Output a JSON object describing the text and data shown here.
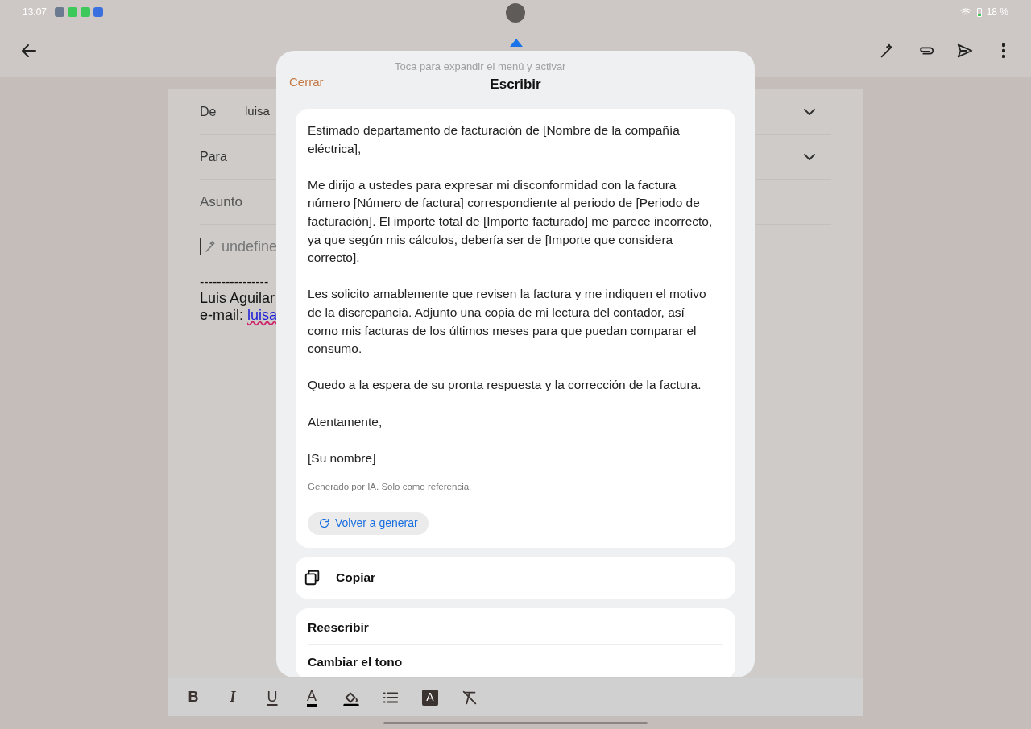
{
  "status_bar": {
    "time": "13:07",
    "battery": "18 %"
  },
  "compose": {
    "fields": [
      {
        "label": "De",
        "value": "luisa",
        "dropdown": true
      },
      {
        "label": "Para",
        "dropdown": true
      },
      {
        "label": "Asunto",
        "dropdown": false
      }
    ],
    "body_placeholder": "undefine",
    "signature": {
      "divider": "----------------",
      "name": "Luis Aguilar",
      "email_label": "e-mail:",
      "email_link": "luisa"
    }
  },
  "format_toolbar": [
    {
      "kind": "bold",
      "glyph": "B"
    },
    {
      "kind": "italic",
      "glyph": "I"
    },
    {
      "kind": "underline",
      "glyph": "U"
    },
    {
      "kind": "text-color",
      "glyph": "A"
    },
    {
      "kind": "fill"
    },
    {
      "kind": "list"
    },
    {
      "kind": "highlight",
      "glyph": "A"
    },
    {
      "kind": "clear"
    }
  ],
  "tooltip": "Toca para expandir el menú y activar",
  "sheet": {
    "close": "Cerrar",
    "title": "Escribir",
    "paragraphs": [
      "Estimado departamento de facturación de [Nombre de la compañía eléctrica],",
      "Me dirijo a ustedes para expresar mi disconformidad con la factura número [Número de factura] correspondiente al periodo de [Periodo de facturación]. El importe total de [Importe facturado] me parece incorrecto, ya que según mis cálculos, debería ser de [Importe que considera correcto].",
      "Les solicito amablemente que revisen la factura y me indiquen el motivo de la discrepancia. Adjunto una copia de mi lectura del contador, así como mis facturas de los últimos meses para que puedan comparar el consumo.",
      "Quedo a la espera de su pronta respuesta y la corrección de la factura.",
      "Atentamente,",
      "[Su nombre]"
    ],
    "disclaimer": "Generado por IA. Solo como referencia.",
    "regenerate": "Volver a generar",
    "copy": "Copiar",
    "options": [
      "Reescribir",
      "Cambiar el tono"
    ]
  }
}
